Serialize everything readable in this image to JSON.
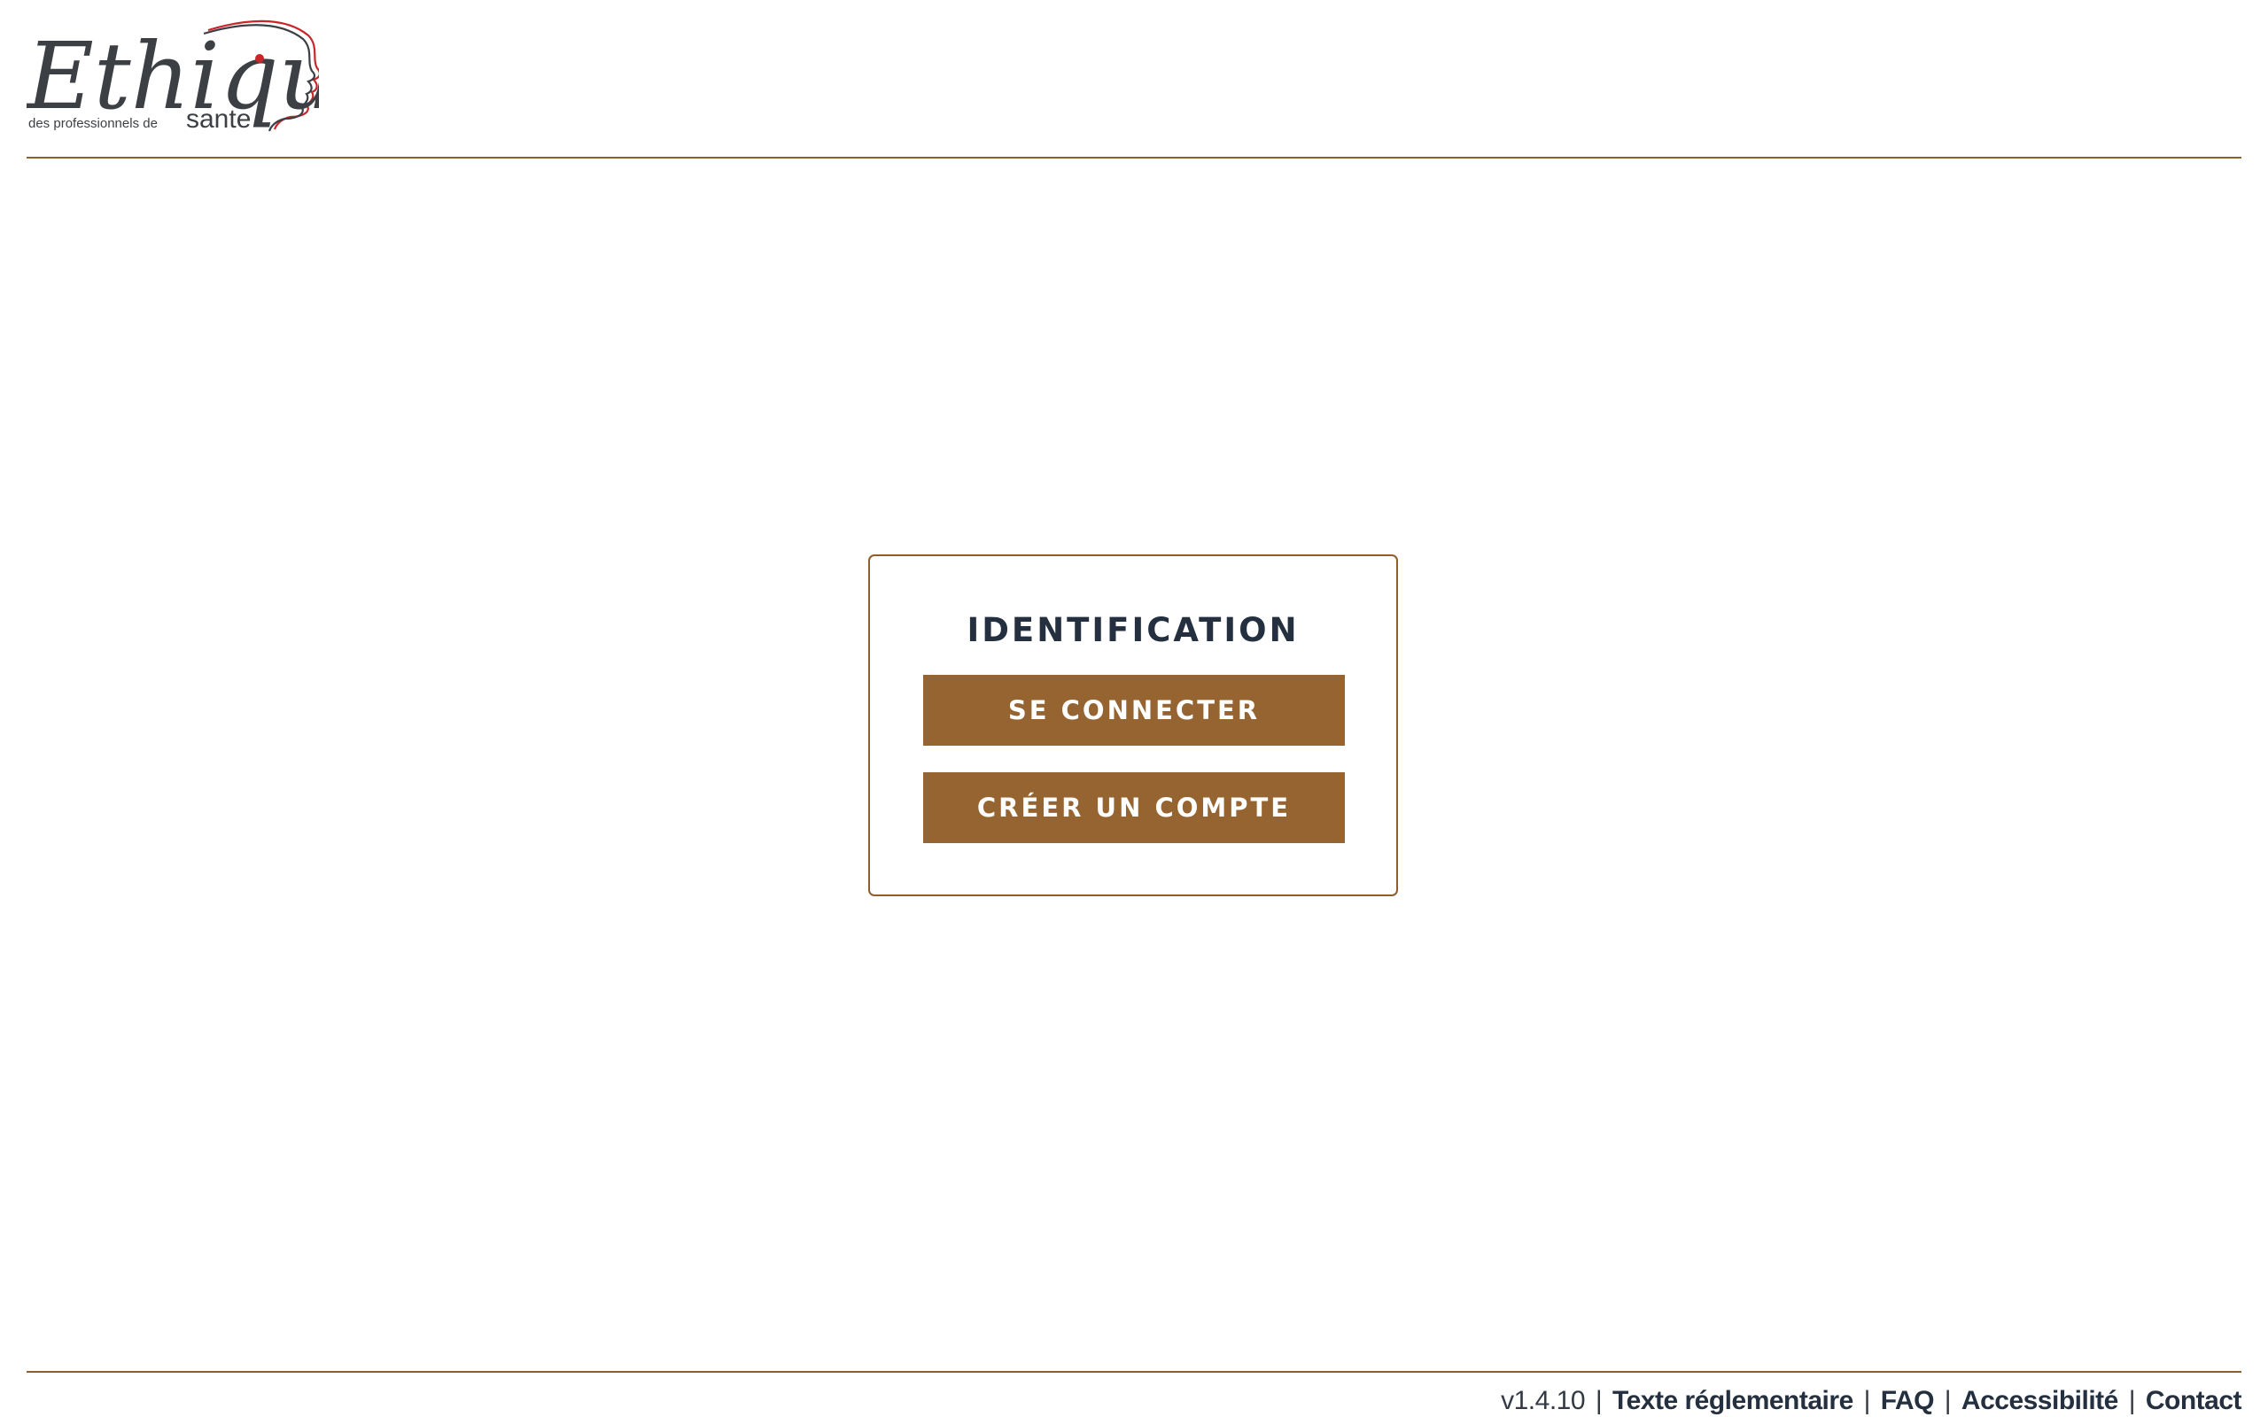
{
  "header": {
    "logo": {
      "word": "Ethique",
      "subtitle": "des professionnels de",
      "tagline": "sante",
      "alt_colors": [
        "#3c3f44",
        "#c8262b"
      ]
    }
  },
  "card": {
    "title": "IDENTIFICATION",
    "login_label": "SE CONNECTER",
    "register_label": "CRÉER UN COMPTE"
  },
  "footer": {
    "version": "v1.4.10",
    "separator": "|",
    "links": {
      "regulation": "Texte réglementaire",
      "faq": "FAQ",
      "accessibility": "Accessibilité",
      "contact": "Contact"
    }
  },
  "colors": {
    "accent": "#956430",
    "rule": "#8f5e2a",
    "heading": "#24303f",
    "background": "#ffffff"
  }
}
